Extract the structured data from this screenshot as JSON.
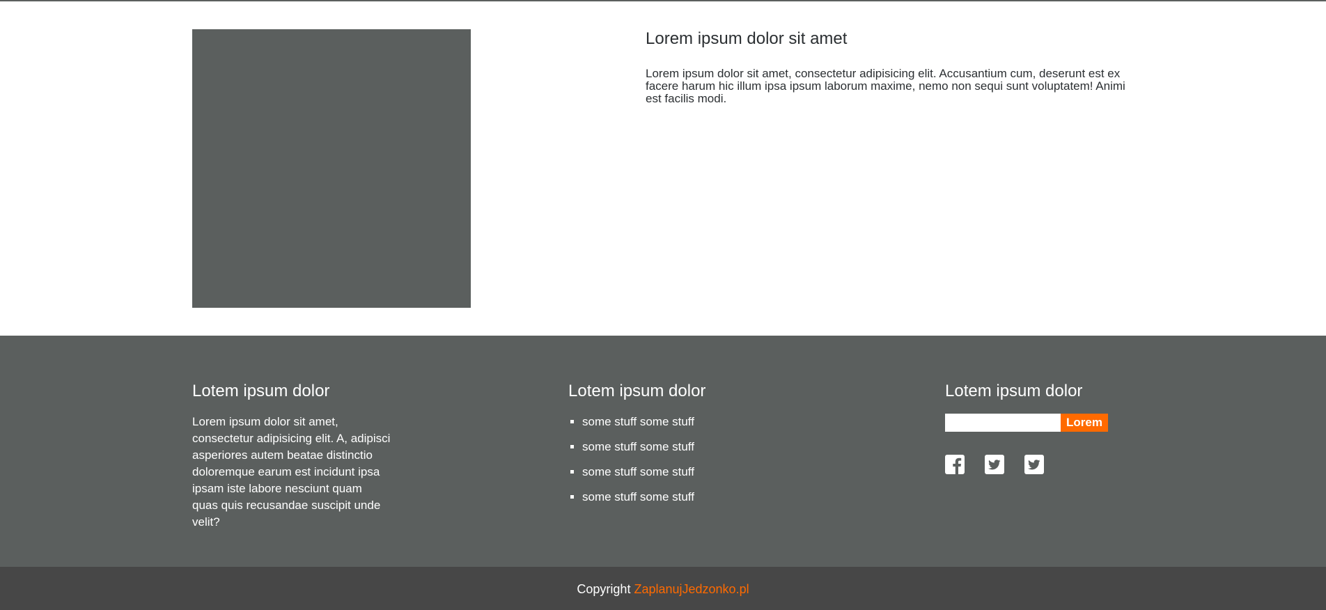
{
  "hero": {
    "title": "Lorem ipsum dolor sit amet",
    "text": "Lorem ipsum dolor sit amet, consectetur adipisicing elit. Accusantium cum, deserunt est ex facere harum hic illum ipsa ipsum laborum maxime, nemo non sequi sunt voluptatem! Animi est facilis modi."
  },
  "footer": {
    "col1": {
      "heading": "Lotem ipsum dolor",
      "text": "Lorem ipsum dolor sit amet, consectetur adipisicing elit. A, adipisci asperiores autem beatae distinctio doloremque earum est incidunt ipsa ipsam iste labore nesciunt quam quas quis recusandae suscipit unde velit?"
    },
    "col2": {
      "heading": "Lotem ipsum dolor",
      "items": [
        "some stuff some stuff",
        "some stuff some stuff",
        "some stuff some stuff",
        "some stuff some stuff"
      ]
    },
    "col3": {
      "heading": "Lotem ipsum dolor",
      "search": {
        "value": "",
        "button_label": "Lorem"
      },
      "social": [
        "facebook-icon",
        "twitter-icon",
        "twitter-icon"
      ]
    }
  },
  "bottom": {
    "copyright_label": "Copyright",
    "link_text": "ZaplanujJedzonko.pl"
  },
  "colors": {
    "accent": "#ff6a00",
    "dark_panel": "#5b5f5e",
    "bottom_bar": "#474747"
  }
}
